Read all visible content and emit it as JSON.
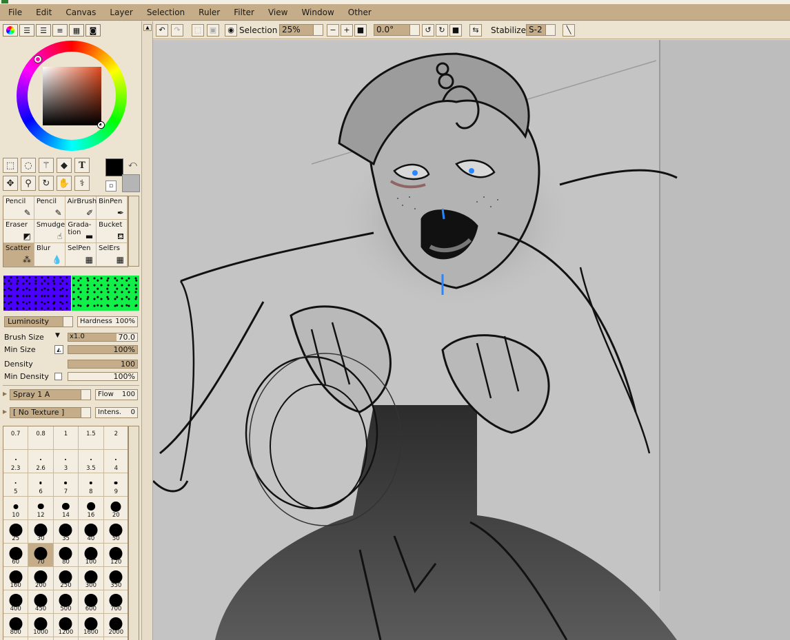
{
  "menu": [
    "File",
    "Edit",
    "Canvas",
    "Layer",
    "Selection",
    "Ruler",
    "Filter",
    "View",
    "Window",
    "Other"
  ],
  "colors": {
    "foreground": "#000000",
    "background": "#b5b5b5",
    "accent": "#c6ad8a",
    "panel": "#ece3d1"
  },
  "toolbar": {
    "selection_label": "Selection",
    "zoom": "25%",
    "rotation": "0.0°",
    "stabilizer_label": "Stabilizer",
    "stabilizer_value": "S-2"
  },
  "brushes": [
    {
      "label": "Pencil",
      "icon": "pencil-icon",
      "glyph": "✎"
    },
    {
      "label": "Pencil",
      "icon": "pencil-icon",
      "glyph": "✎"
    },
    {
      "label": "AirBrush",
      "icon": "airbrush-icon",
      "glyph": "✐"
    },
    {
      "label": "BinPen",
      "icon": "pen-icon",
      "glyph": "✒"
    },
    {
      "label": "Eraser",
      "icon": "eraser-icon",
      "glyph": "◩"
    },
    {
      "label": "Smudge",
      "icon": "smudge-icon",
      "glyph": "☝"
    },
    {
      "label": "Grada-\ntion",
      "icon": "gradation-icon",
      "glyph": "▬"
    },
    {
      "label": "Bucket",
      "icon": "bucket-icon",
      "glyph": "⛾"
    },
    {
      "label": "Scatter",
      "icon": "scatter-icon",
      "glyph": "⁂",
      "selected": true
    },
    {
      "label": "Blur",
      "icon": "blur-icon",
      "glyph": "💧"
    },
    {
      "label": "SelPen",
      "icon": "selpen-icon",
      "glyph": "▦"
    },
    {
      "label": "SelErs",
      "icon": "selers-icon",
      "glyph": "▦"
    }
  ],
  "brush_settings": {
    "blend_mode": "Luminosity",
    "hardness_label": "Hardness",
    "hardness_value": "100%",
    "brush_size_label": "Brush Size",
    "brush_size_multiplier": "x1.0",
    "brush_size_value": "70.0",
    "brush_size_fraction": 0.7,
    "min_size_label": "Min Size",
    "min_size_value": "100%",
    "density_label": "Density",
    "density_value": "100",
    "min_density_label": "Min Density",
    "min_density_value": "100%",
    "shape": "Spray 1 A",
    "flow_label": "Flow",
    "flow_value": "100",
    "texture": "[ No Texture ]",
    "intensity_label": "Intens.",
    "intensity_value": "0"
  },
  "sizes": [
    "0.7",
    "0.8",
    "1",
    "1.5",
    "2",
    "2.3",
    "2.6",
    "3",
    "3.5",
    "4",
    "5",
    "6",
    "7",
    "8",
    "9",
    "10",
    "12",
    "14",
    "16",
    "20",
    "25",
    "30",
    "35",
    "40",
    "50",
    "60",
    "70",
    "80",
    "100",
    "120",
    "160",
    "200",
    "250",
    "300",
    "350",
    "400",
    "450",
    "500",
    "600",
    "700",
    "800",
    "1000",
    "1200",
    "1600",
    "2000",
    "",
    "",
    "",
    "",
    ""
  ],
  "selected_size": "70"
}
